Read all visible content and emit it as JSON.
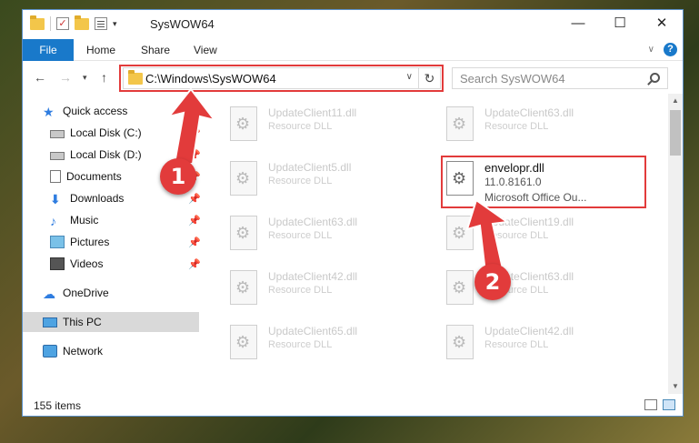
{
  "window": {
    "title": "SysWOW64",
    "controls": {
      "minimize": "—",
      "maximize": "☐",
      "close": "✕"
    }
  },
  "ribbon": {
    "tabs": [
      "File",
      "Home",
      "Share",
      "View"
    ],
    "help": "?"
  },
  "address": {
    "path": "C:\\Windows\\SysWOW64",
    "search_placeholder": "Search SysWOW64"
  },
  "nav": {
    "items": [
      {
        "label": "Quick access",
        "icon": "star-icon"
      },
      {
        "label": "Local Disk (C:)",
        "icon": "disk-icon",
        "pinned": true
      },
      {
        "label": "Local Disk (D:)",
        "icon": "disk-icon",
        "pinned": true
      },
      {
        "label": "Documents",
        "icon": "documents-icon",
        "pinned": true
      },
      {
        "label": "Downloads",
        "icon": "downloads-icon",
        "pinned": true
      },
      {
        "label": "Music",
        "icon": "music-icon",
        "pinned": true
      },
      {
        "label": "Pictures",
        "icon": "pictures-icon",
        "pinned": true
      },
      {
        "label": "Videos",
        "icon": "videos-icon",
        "pinned": true
      },
      {
        "label": "OneDrive",
        "icon": "onedrive-icon"
      },
      {
        "label": "This PC",
        "icon": "pc-icon",
        "selected": true
      },
      {
        "label": "Network",
        "icon": "network-icon"
      }
    ]
  },
  "files": [
    {
      "name": "UpdateClient11.dll",
      "type": "Resource DLL"
    },
    {
      "name": "UpdateClient63.dll",
      "type": "Resource DLL"
    },
    {
      "name": "UpdateClient5.dll",
      "type": "Resource DLL"
    },
    {
      "name": "envelopr.dll",
      "version": "11.0.8161.0",
      "company": "Microsoft Office Ou...",
      "highlighted": true
    },
    {
      "name": "UpdateClient63.dll",
      "type": "Resource DLL"
    },
    {
      "name": "UpdateClient19.dll",
      "type": "Resource DLL"
    },
    {
      "name": "UpdateClient42.dll",
      "type": "Resource DLL"
    },
    {
      "name": "UpdateClient63.dll",
      "type": "Resource DLL"
    },
    {
      "name": "UpdateClient65.dll",
      "type": "Resource DLL"
    },
    {
      "name": "UpdateClient42.dll",
      "type": "Resource DLL"
    }
  ],
  "status": {
    "item_count": "155 items"
  },
  "annotations": {
    "badge1": "1",
    "badge2": "2",
    "color": "#e23b3b"
  }
}
